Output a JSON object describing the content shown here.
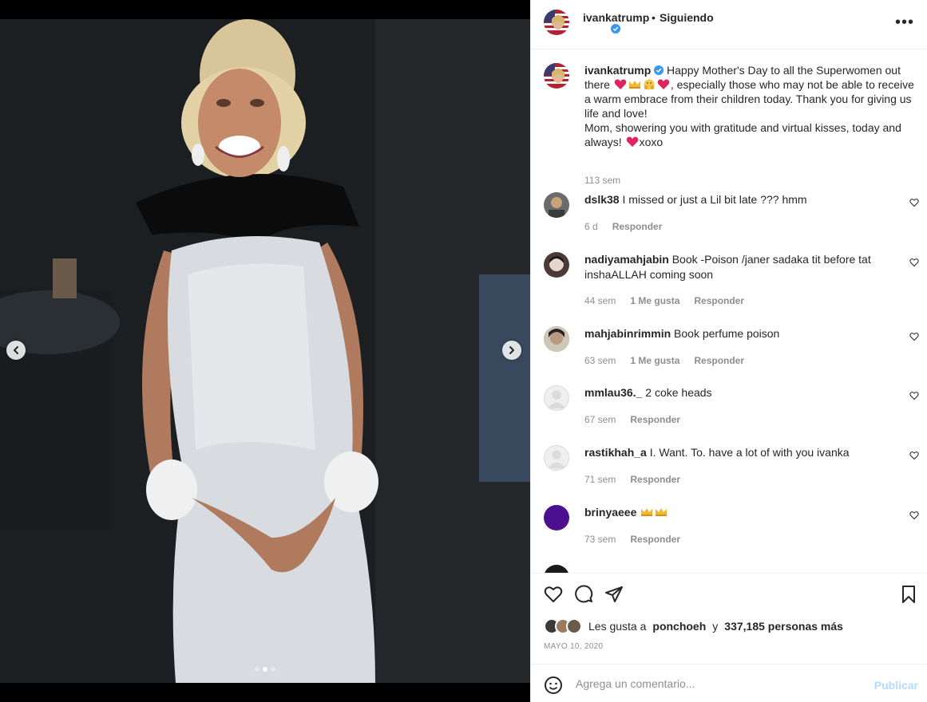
{
  "post": {
    "username": "ivankatrump",
    "follow_status": "Siguiendo",
    "separator": "•",
    "more_label": "•••"
  },
  "caption": {
    "username": "ivankatrump",
    "text_part1": "Happy Mother's Day to all the Superwomen out there",
    "text_part2": ", especially those who may not be able to receive a warm embrace from their children today. Thank you for giving us life and love!",
    "text_part3": "Mom, showering you with gratitude and virtual kisses, today and always!",
    "text_part4": "xoxo",
    "time": "113 sem"
  },
  "comments": [
    {
      "username": "dslk38",
      "text": "I missed or just a Lil bit late ??? hmm",
      "time": "6 d",
      "likes": "",
      "reply": "Responder",
      "avatar_color": "#6b6b6b"
    },
    {
      "username": "nadiyamahjabin",
      "text": "Book -Poison /janer sadaka tit before tat inshaALLAH coming soon",
      "time": "44 sem",
      "likes": "1 Me gusta",
      "reply": "Responder",
      "avatar_color": "#4a3b36"
    },
    {
      "username": "mahjabinrimmin",
      "text": "Book perfume poison",
      "time": "63 sem",
      "likes": "1 Me gusta",
      "reply": "Responder",
      "avatar_color": "#7a6a58"
    },
    {
      "username": "mmlau36._",
      "text": "2 coke heads",
      "time": "67 sem",
      "likes": "",
      "reply": "Responder",
      "avatar_color": "#dbdbdb"
    },
    {
      "username": "rastikhah_a",
      "text": "I. Want. To. have a lot of with you ivanka",
      "time": "71 sem",
      "likes": "",
      "reply": "Responder",
      "avatar_color": "#dbdbdb"
    },
    {
      "username": "brinyaeee",
      "text": "",
      "time": "73 sem",
      "likes": "",
      "reply": "Responder",
      "avatar_color": "#4b0f8f"
    }
  ],
  "likes": {
    "prefix": "Les gusta a",
    "user": "ponchoeh",
    "connector": "y",
    "count": "337,185 personas más"
  },
  "date": "MAYO 10, 2020",
  "composer": {
    "placeholder": "Agrega un comentario...",
    "post_label": "Publicar"
  },
  "colors": {
    "verified": "#3897f0",
    "secondary_text": "#8e8e8e",
    "publish_disabled": "#b3dbff",
    "heart_emoji": "#e0245e",
    "crown_emoji": "#f6b72d"
  }
}
